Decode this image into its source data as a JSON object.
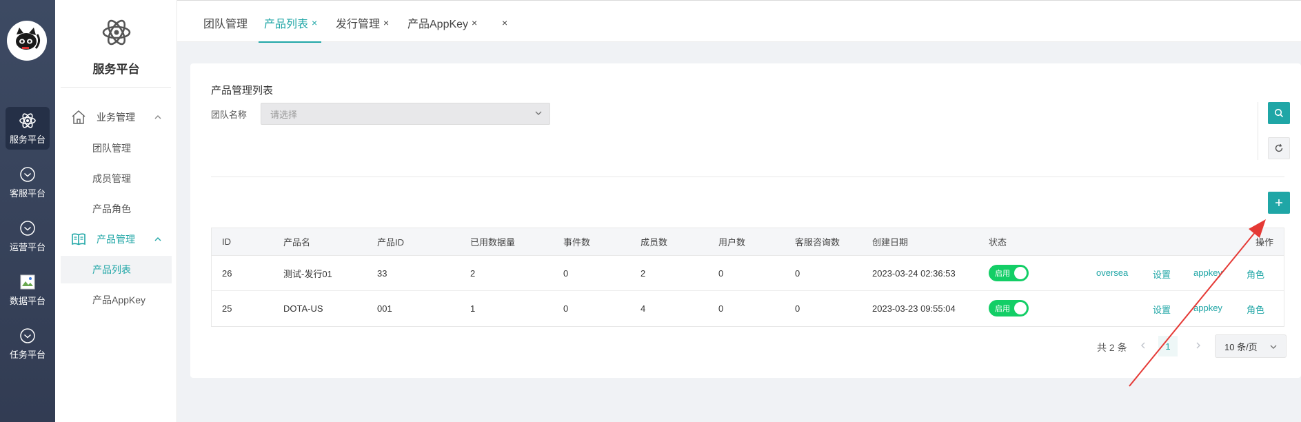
{
  "rail": {
    "items": [
      {
        "label": "服务平台",
        "icon": "atom-icon"
      },
      {
        "label": "客服平台",
        "icon": "chevron-circle-icon"
      },
      {
        "label": "运营平台",
        "icon": "chevron-circle-icon"
      },
      {
        "label": "数据平台",
        "icon": "broken-image-icon"
      },
      {
        "label": "任务平台",
        "icon": "chevron-circle-icon"
      }
    ]
  },
  "sidebar": {
    "brand": "服务平台",
    "groups": [
      {
        "label": "业务管理",
        "icon": "home-icon",
        "items": [
          "团队管理",
          "成员管理",
          "产品角色"
        ]
      },
      {
        "label": "产品管理",
        "icon": "book-icon",
        "items": [
          "产品列表",
          "产品AppKey"
        ]
      }
    ],
    "active_item": "产品列表"
  },
  "tabs": [
    {
      "label": "团队管理",
      "closable": false
    },
    {
      "label": "产品列表",
      "closable": true
    },
    {
      "label": "发行管理",
      "closable": true
    },
    {
      "label": "产品AppKey",
      "closable": true
    },
    {
      "label": "",
      "closable": true
    }
  ],
  "close_glyph": "×",
  "page": {
    "title": "产品管理列表",
    "filter_label": "团队名称",
    "filter_placeholder": "请选择"
  },
  "table": {
    "columns": [
      "ID",
      "产品名",
      "产品ID",
      "已用数据量",
      "事件数",
      "成员数",
      "用户数",
      "客服咨询数",
      "创建日期",
      "状态",
      "操作"
    ],
    "rows": [
      {
        "id": "26",
        "name": "测试-发行01",
        "product_id": "33",
        "used": "2",
        "events": "0",
        "members": "2",
        "users": "0",
        "consults": "0",
        "created": "2023-03-24 02:36:53",
        "status": "启用",
        "actions": [
          "oversea",
          "设置",
          "appkey",
          "角色"
        ]
      },
      {
        "id": "25",
        "name": "DOTA-US",
        "product_id": "001",
        "used": "1",
        "events": "0",
        "members": "4",
        "users": "0",
        "consults": "0",
        "created": "2023-03-23 09:55:04",
        "status": "启用",
        "actions": [
          "设置",
          "appkey",
          "角色"
        ]
      }
    ]
  },
  "pagination": {
    "total": "共 2 条",
    "current": "1",
    "page_size": "10 条/页"
  },
  "colors": {
    "accent": "#1fa6a6",
    "rail": "#3d4a63",
    "toggle_on": "#13ce66",
    "annotation": "#e53935"
  }
}
